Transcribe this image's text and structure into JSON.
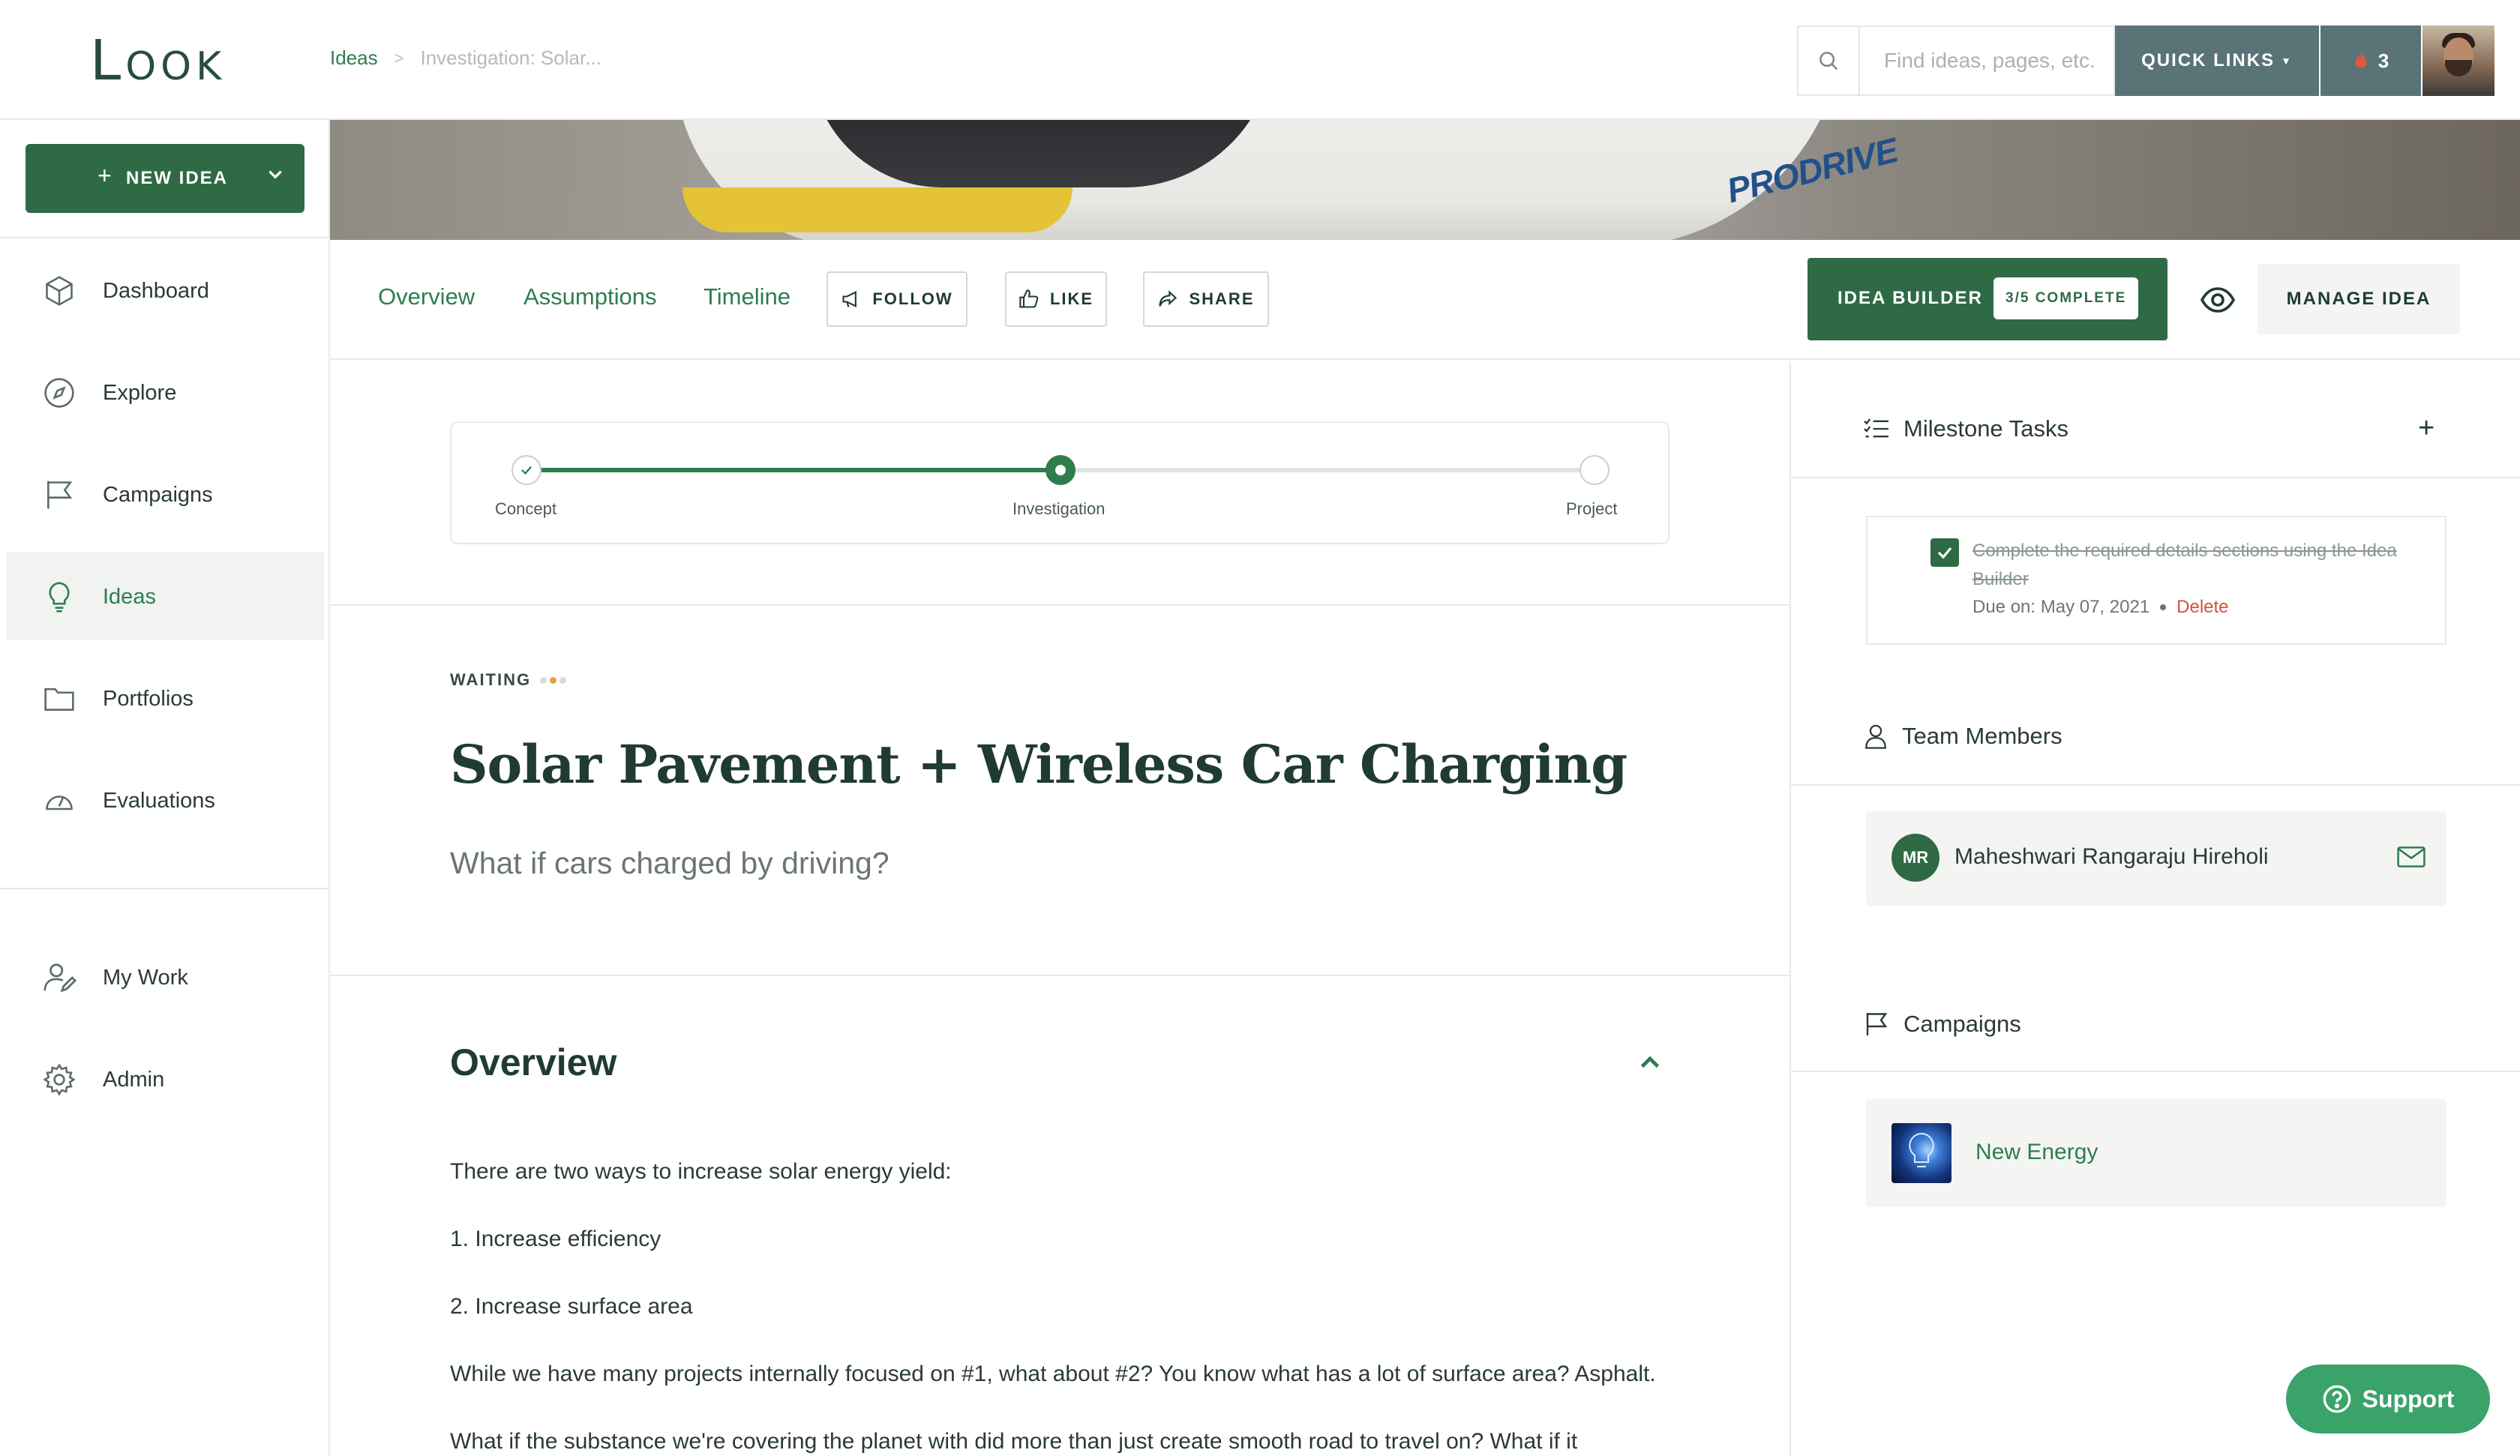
{
  "header": {
    "logo": "Look",
    "breadcrumb": {
      "root": "Ideas",
      "separator": ">",
      "current": "Investigation: Solar..."
    },
    "search_placeholder": "Find ideas, pages, etc.",
    "quick_links_label": "QUICK LINKS",
    "notification_count": "3"
  },
  "sidebar": {
    "new_idea_label": "NEW IDEA",
    "new_idea_plus": "+",
    "items": [
      {
        "label": "Dashboard",
        "icon": "cube-icon"
      },
      {
        "label": "Explore",
        "icon": "compass-icon"
      },
      {
        "label": "Campaigns",
        "icon": "flag-icon"
      },
      {
        "label": "Ideas",
        "icon": "lightbulb-icon",
        "active": true
      },
      {
        "label": "Portfolios",
        "icon": "folder-icon"
      },
      {
        "label": "Evaluations",
        "icon": "gauge-icon"
      }
    ],
    "bottom_items": [
      {
        "label": "My Work",
        "icon": "user-edit-icon"
      },
      {
        "label": "Admin",
        "icon": "gear-icon"
      }
    ]
  },
  "banner": {
    "brand_text": "PRODRIVE"
  },
  "tabs": {
    "overview": "Overview",
    "assumptions": "Assumptions",
    "timeline": "Timeline",
    "follow": "FOLLOW",
    "like": "LIKE",
    "share": "SHARE",
    "idea_builder": "IDEA BUILDER",
    "idea_builder_badge": "3/5 COMPLETE",
    "manage": "MANAGE IDEA"
  },
  "progress": {
    "stages": [
      "Concept",
      "Investigation",
      "Project"
    ],
    "current_index": 1,
    "fraction_complete": 0.5
  },
  "idea": {
    "status": "WAITING",
    "title": "Solar Pavement + Wireless Car Charging",
    "subtitle": "What if cars charged by driving?"
  },
  "overview": {
    "heading": "Overview",
    "paragraphs": [
      "There are two ways to increase solar energy yield:",
      "1. Increase efficiency",
      "2. Increase surface area",
      "While we have many projects internally focused on #1, what about #2? You know what has a lot of surface area? Asphalt.",
      "What if the substance we're covering the planet with did more than just create smooth road to travel on? What if it"
    ]
  },
  "right_panel": {
    "milestone_heading": "Milestone Tasks",
    "add_label": "+",
    "task": {
      "text": "Complete the required details sections using the Idea Builder",
      "due": "Due on: May 07, 2021",
      "delete": "Delete"
    },
    "team_heading": "Team Members",
    "member": {
      "initials": "MR",
      "name": "Maheshwari Rangaraju Hireholi"
    },
    "campaigns_heading": "Campaigns",
    "campaign": {
      "name": "New Energy"
    }
  },
  "support_label": "Support",
  "colors": {
    "brand_green": "#2e6b45",
    "link_green": "#2e7d4f",
    "slate": "#5a7376",
    "delete_red": "#d0533a",
    "support_green": "#3aa36a"
  }
}
